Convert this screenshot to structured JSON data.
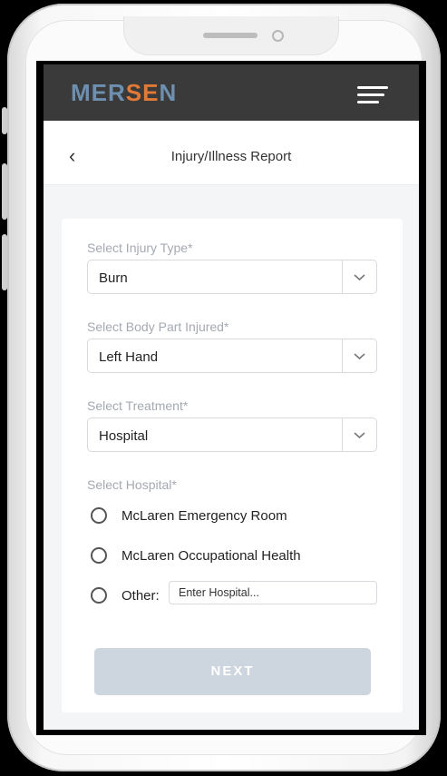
{
  "header": {
    "logo_part1": "MER",
    "logo_part2": "SE",
    "logo_part3": "N",
    "menu_icon": "hamburger-icon"
  },
  "titlebar": {
    "back_icon": "chevron-left-icon",
    "back_glyph": "‹",
    "title": "Injury/Illness Report"
  },
  "form": {
    "injury_type": {
      "label": "Select Injury Type*",
      "value": "Burn"
    },
    "body_part": {
      "label": "Select Body Part Injured*",
      "value": "Left Hand"
    },
    "treatment": {
      "label": "Select Treatment*",
      "value": "Hospital"
    },
    "hospital": {
      "label": "Select Hospital*",
      "options": [
        "McLaren Emergency Room",
        "McLaren Occupational Health",
        "Other:"
      ],
      "other_placeholder": "Enter Hospital..."
    },
    "next_label": "NEXT"
  },
  "colors": {
    "appbar": "#3a3a3a",
    "logo_blue": "#6d8fb0",
    "logo_orange": "#e07a36",
    "next_disabled": "#cdd5de"
  }
}
